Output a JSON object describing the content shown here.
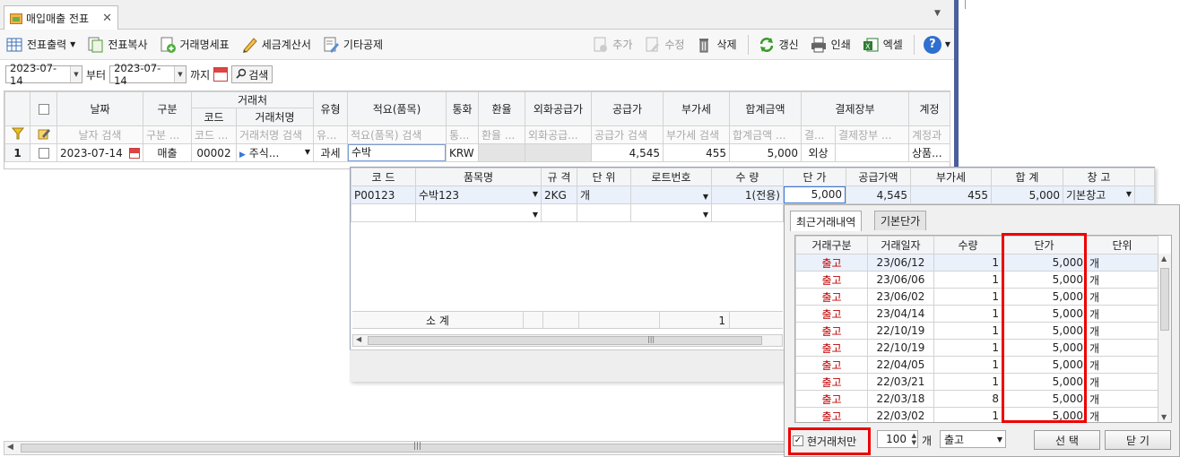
{
  "tab": {
    "title": "매입매출 전표",
    "close": "✕"
  },
  "toolbar": {
    "print": "전표출력",
    "copy": "전표복사",
    "statement": "거래명세표",
    "tax_invoice": "세금계산서",
    "other_deduction": "기타공제",
    "add": "추가",
    "edit": "수정",
    "delete": "삭제",
    "refresh": "갱신",
    "print2": "인쇄",
    "excel": "엑셀",
    "help": "?"
  },
  "filter": {
    "date_from": "2023-07-14",
    "from_label": "부터",
    "date_to": "2023-07-14",
    "to_label": "까지",
    "search": "검색"
  },
  "grid": {
    "headers": {
      "date": "날짜",
      "type": "구분",
      "partner": "거래처",
      "code": "코드",
      "partner_name": "거래처명",
      "kind": "유형",
      "summary": "적요(품목)",
      "currency": "통화",
      "rate": "환율",
      "foreign_amt": "외화공급가",
      "supply": "공급가",
      "vat": "부가세",
      "total": "합계금액",
      "settlement": "결제장부",
      "account": "계정"
    },
    "filters": {
      "date": "날자 검색",
      "type": "구분 ...",
      "code": "코드 ...",
      "partner_name": "거래처명 검색",
      "kind": "유...",
      "summary": "적요(품목) 검색",
      "currency": "통...",
      "rate": "환율 ...",
      "foreign_amt": "외화공급...",
      "supply": "공급가 검색",
      "vat": "부가세 검색",
      "total": "합계금액 ...",
      "settle1": "결...",
      "settle2": "결제장부 ...",
      "account": "계정과"
    },
    "row": {
      "num": "1",
      "date": "2023-07-14",
      "type": "매출",
      "code": "00002",
      "partner_name": "주식...",
      "kind": "과세",
      "summary": "수박",
      "currency": "KRW",
      "rate": "",
      "foreign_amt": "",
      "supply": "4,545",
      "vat": "455",
      "total": "5,000",
      "settle": "외상",
      "account": "상품..."
    }
  },
  "items": {
    "headers": {
      "code": "코 드",
      "name": "품목명",
      "spec": "규 격",
      "unit": "단 위",
      "lot": "로트번호",
      "qty": "수 량",
      "price": "단 가",
      "supply": "공급가액",
      "vat": "부가세",
      "total": "합 계",
      "warehouse": "창 고"
    },
    "rows": [
      {
        "code": "P00123",
        "name": "수박123",
        "spec": "2KG",
        "unit": "개",
        "lot": "",
        "qty": "1(전용)",
        "price": "5,000",
        "supply": "4,545",
        "vat": "455",
        "total": "5,000",
        "warehouse": "기본창고"
      }
    ],
    "subtotal_label": "소    계",
    "subtotal_qty": "1"
  },
  "recent": {
    "tabs": [
      "최근거래내역",
      "기본단가"
    ],
    "headers": {
      "kind": "거래구분",
      "date": "거래일자",
      "qty": "수량",
      "price": "단가",
      "unit": "단위"
    },
    "rows": [
      {
        "kind": "출고",
        "date": "23/06/12",
        "qty": "1",
        "price": "5,000",
        "unit": "개"
      },
      {
        "kind": "출고",
        "date": "23/06/06",
        "qty": "1",
        "price": "5,000",
        "unit": "개"
      },
      {
        "kind": "출고",
        "date": "23/06/02",
        "qty": "1",
        "price": "5,000",
        "unit": "개"
      },
      {
        "kind": "출고",
        "date": "23/04/14",
        "qty": "1",
        "price": "5,000",
        "unit": "개"
      },
      {
        "kind": "출고",
        "date": "22/10/19",
        "qty": "1",
        "price": "5,000",
        "unit": "개"
      },
      {
        "kind": "출고",
        "date": "22/10/19",
        "qty": "1",
        "price": "5,000",
        "unit": "개"
      },
      {
        "kind": "출고",
        "date": "22/04/05",
        "qty": "1",
        "price": "5,000",
        "unit": "개"
      },
      {
        "kind": "출고",
        "date": "22/03/21",
        "qty": "1",
        "price": "5,000",
        "unit": "개"
      },
      {
        "kind": "출고",
        "date": "22/03/18",
        "qty": "8",
        "price": "5,000",
        "unit": "개"
      },
      {
        "kind": "출고",
        "date": "22/03/02",
        "qty": "1",
        "price": "5,000",
        "unit": "개"
      }
    ],
    "current_partner_only": "현거래처만",
    "count": "100",
    "count_unit": "개",
    "filter_kind": "출고",
    "select": "선 택",
    "close": "닫 기"
  },
  "colors": {
    "highlight": "#e00000",
    "out_text": "#c00000",
    "accent": "#4a5f9b"
  }
}
